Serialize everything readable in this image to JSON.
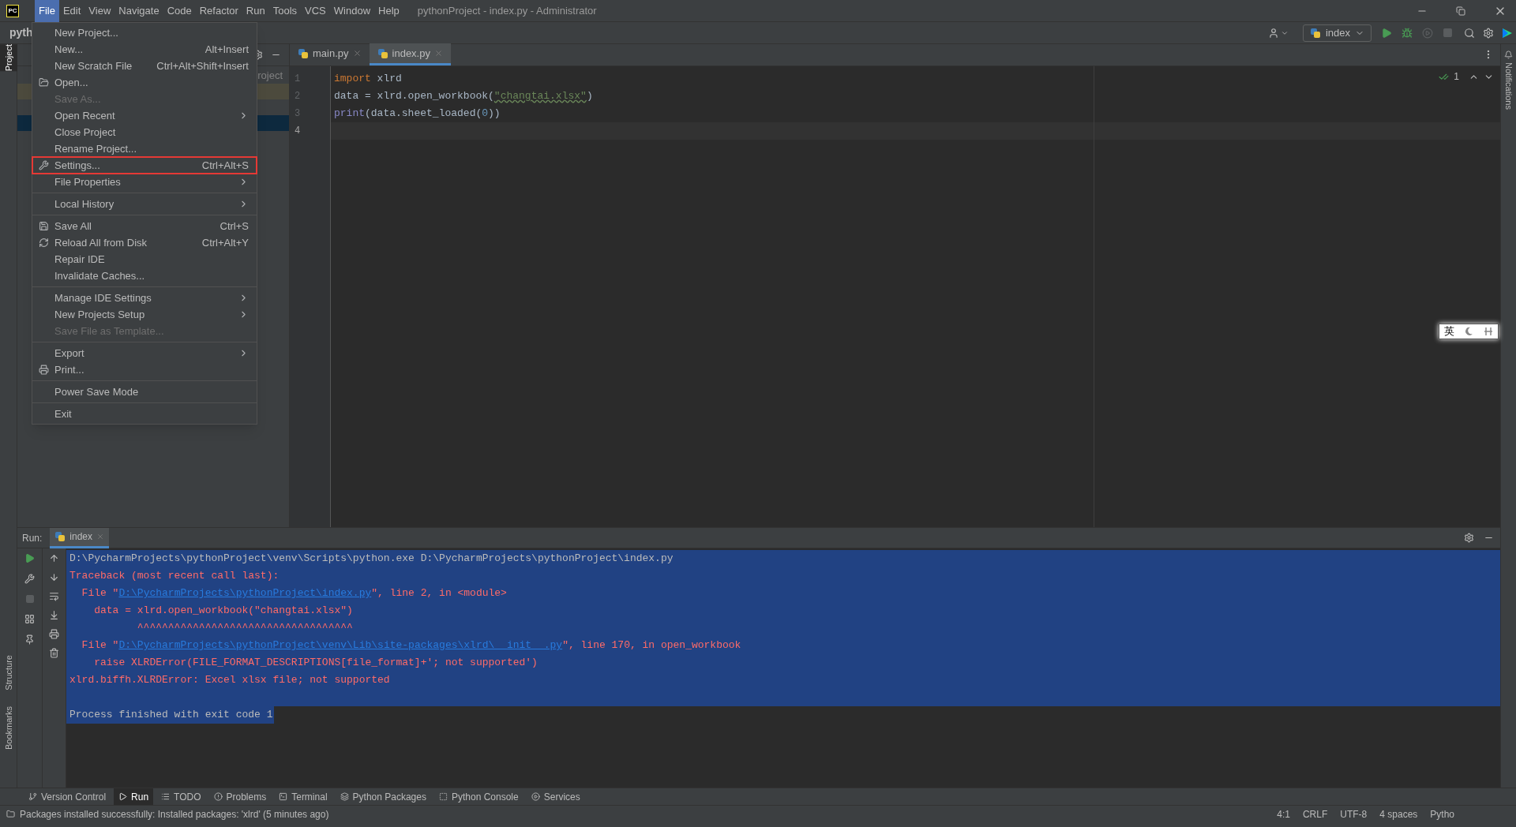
{
  "window": {
    "title": "pythonProject - index.py - Administrator",
    "logo": "PC"
  },
  "menu_bar": [
    {
      "label": "File",
      "selected": true
    },
    {
      "label": "Edit",
      "selected": false
    },
    {
      "label": "View",
      "selected": false
    },
    {
      "label": "Navigate",
      "selected": false
    },
    {
      "label": "Code",
      "selected": false
    },
    {
      "label": "Refactor",
      "selected": false
    },
    {
      "label": "Run",
      "selected": false
    },
    {
      "label": "Tools",
      "selected": false
    },
    {
      "label": "VCS",
      "selected": false
    },
    {
      "label": "Window",
      "selected": false
    },
    {
      "label": "Help",
      "selected": false
    }
  ],
  "breadcrumb": "pyth",
  "run_config": "index",
  "left_stripe": [
    {
      "label": "Project",
      "selected": true
    },
    {
      "label": "Structure",
      "selected": false
    },
    {
      "label": "Bookmarks",
      "selected": false
    }
  ],
  "right_stripe": [
    {
      "label": "Notifications"
    }
  ],
  "project_panel": {
    "rows": [
      {
        "text": "roject",
        "selected": false,
        "color": "#3c3f41"
      },
      {
        "selected": false,
        "color": "#4c4a3d"
      },
      {
        "selected": true
      }
    ]
  },
  "file_menu": [
    {
      "kind": "plain",
      "label": "New Project...",
      "disabled": false,
      "submenu": false,
      "annotated": false
    },
    {
      "kind": "plain",
      "label": "New...",
      "shortcut": "Alt+Insert",
      "disabled": false,
      "submenu": false,
      "annotated": false
    },
    {
      "kind": "plain",
      "label": "New Scratch File",
      "shortcut": "Ctrl+Alt+Shift+Insert",
      "disabled": false,
      "submenu": false,
      "annotated": false
    },
    {
      "kind": "open",
      "label": "Open...",
      "disabled": false,
      "submenu": false,
      "annotated": false
    },
    {
      "kind": "plain",
      "label": "Save As...",
      "disabled": true,
      "submenu": false,
      "annotated": false
    },
    {
      "kind": "plain",
      "label": "Open Recent",
      "disabled": false,
      "submenu": true,
      "annotated": false
    },
    {
      "kind": "plain",
      "label": "Close Project",
      "disabled": false,
      "submenu": false,
      "annotated": false
    },
    {
      "kind": "plain",
      "label": "Rename Project...",
      "disabled": false,
      "submenu": false,
      "annotated": false
    },
    {
      "kind": "settings",
      "label": "Settings...",
      "shortcut": "Ctrl+Alt+S",
      "disabled": false,
      "submenu": false,
      "annotated": true
    },
    {
      "kind": "plain",
      "label": "File Properties",
      "disabled": false,
      "submenu": true,
      "annotated": false
    },
    {
      "kind": "separator"
    },
    {
      "kind": "plain",
      "label": "Local History",
      "disabled": false,
      "submenu": true,
      "annotated": false
    },
    {
      "kind": "separator"
    },
    {
      "kind": "save",
      "label": "Save All",
      "shortcut": "Ctrl+S",
      "disabled": false,
      "submenu": false,
      "annotated": false
    },
    {
      "kind": "reload",
      "label": "Reload All from Disk",
      "shortcut": "Ctrl+Alt+Y",
      "disabled": false,
      "submenu": false,
      "annotated": false
    },
    {
      "kind": "plain",
      "label": "Repair IDE",
      "disabled": false,
      "submenu": false,
      "annotated": false
    },
    {
      "kind": "plain",
      "label": "Invalidate Caches...",
      "disabled": false,
      "submenu": false,
      "annotated": false
    },
    {
      "kind": "separator"
    },
    {
      "kind": "plain",
      "label": "Manage IDE Settings",
      "disabled": false,
      "submenu": true,
      "annotated": false
    },
    {
      "kind": "plain",
      "label": "New Projects Setup",
      "disabled": false,
      "submenu": true,
      "annotated": false
    },
    {
      "kind": "plain",
      "label": "Save File as Template...",
      "disabled": true,
      "submenu": false,
      "annotated": false
    },
    {
      "kind": "separator"
    },
    {
      "kind": "plain",
      "label": "Export",
      "disabled": false,
      "submenu": true,
      "annotated": false
    },
    {
      "kind": "print",
      "label": "Print...",
      "disabled": false,
      "submenu": false,
      "annotated": false
    },
    {
      "kind": "separator"
    },
    {
      "kind": "plain",
      "label": "Power Save Mode",
      "disabled": false,
      "submenu": false,
      "annotated": false
    },
    {
      "kind": "separator"
    },
    {
      "kind": "plain",
      "label": "Exit",
      "disabled": false,
      "submenu": false,
      "annotated": false
    }
  ],
  "editor_tabs": [
    {
      "label": "main.py",
      "selected": false
    },
    {
      "label": "index.py",
      "selected": true
    }
  ],
  "editor": {
    "inspection_count": "1",
    "lines": [
      {
        "number": "1",
        "current": false,
        "tokens": [
          {
            "kind": "keyword",
            "text": "import"
          },
          {
            "kind": "plain",
            "text": " xlrd"
          }
        ]
      },
      {
        "number": "2",
        "current": false,
        "tokens": [
          {
            "kind": "plain",
            "text": "data = xlrd.open_workbook("
          },
          {
            "kind": "string",
            "text": "\"changtai.xlsx\""
          },
          {
            "kind": "plain",
            "text": ")"
          }
        ]
      },
      {
        "number": "3",
        "current": false,
        "tokens": [
          {
            "kind": "builtin",
            "text": "print"
          },
          {
            "kind": "plain",
            "text": "(data.sheet_loaded("
          },
          {
            "kind": "number",
            "text": "0"
          },
          {
            "kind": "plain",
            "text": "))"
          }
        ]
      },
      {
        "number": "4",
        "current": true
      }
    ]
  },
  "ime_widget": {
    "label": "英"
  },
  "run_panel": {
    "label": "Run:",
    "tab": "index",
    "console": [
      {
        "kind": "info",
        "selected": true,
        "parts": [
          {
            "kind": "text",
            "text": "D:\\PycharmProjects\\pythonProject\\venv\\Scripts\\python.exe D:\\PycharmProjects\\pythonProject\\index.py"
          }
        ]
      },
      {
        "kind": "error",
        "selected": true,
        "parts": [
          {
            "kind": "text",
            "text": "Traceback (most recent call last):"
          }
        ]
      },
      {
        "kind": "error",
        "selected": true,
        "parts": [
          {
            "kind": "text",
            "text": "  File \""
          },
          {
            "kind": "link",
            "text": "D:\\PycharmProjects\\pythonProject\\index.py"
          },
          {
            "kind": "text",
            "text": "\", line 2, in <module>"
          }
        ]
      },
      {
        "kind": "error",
        "selected": true,
        "parts": [
          {
            "kind": "text",
            "text": "    data = xlrd.open_workbook(\"changtai.xlsx\")"
          }
        ]
      },
      {
        "kind": "error",
        "selected": true,
        "parts": [
          {
            "kind": "text",
            "text": "           ^^^^^^^^^^^^^^^^^^^^^^^^^^^^^^^^^^^"
          }
        ]
      },
      {
        "kind": "error",
        "selected": true,
        "parts": [
          {
            "kind": "text",
            "text": "  File \""
          },
          {
            "kind": "link",
            "text": "D:\\PycharmProjects\\pythonProject\\venv\\Lib\\site-packages\\xlrd\\__init__.py"
          },
          {
            "kind": "text",
            "text": "\", line 170, in open_workbook"
          }
        ]
      },
      {
        "kind": "error",
        "selected": true,
        "parts": [
          {
            "kind": "text",
            "text": "    raise XLRDError(FILE_FORMAT_DESCRIPTIONS[file_format]+'; not supported')"
          }
        ]
      },
      {
        "kind": "error",
        "selected": true,
        "parts": [
          {
            "kind": "text",
            "text": "xlrd.biffh.XLRDError: Excel xlsx file; not supported"
          }
        ]
      },
      {
        "kind": "info",
        "selected": true
      },
      {
        "kind": "exit",
        "selected": true,
        "parts": [
          {
            "kind": "text",
            "text": "Process finished with exit code 1"
          }
        ]
      }
    ]
  },
  "tool_tabs": [
    {
      "kind": "vcs",
      "label": "Version Control",
      "selected": false
    },
    {
      "kind": "run",
      "label": "Run",
      "selected": true
    },
    {
      "kind": "todo",
      "label": "TODO",
      "selected": false
    },
    {
      "kind": "problems",
      "label": "Problems",
      "selected": false
    },
    {
      "kind": "terminal",
      "label": "Terminal",
      "selected": false
    },
    {
      "kind": "packages",
      "label": "Python Packages",
      "selected": false
    },
    {
      "kind": "console",
      "label": "Python Console",
      "selected": false
    },
    {
      "kind": "services",
      "label": "Services",
      "selected": false
    }
  ],
  "status_bar": {
    "message": "Packages installed successfully: Installed packages: 'xlrd' (5 minutes ago)",
    "items": [
      "4:1",
      "CRLF",
      "UTF-8",
      "4 spaces",
      "Pytho"
    ]
  }
}
